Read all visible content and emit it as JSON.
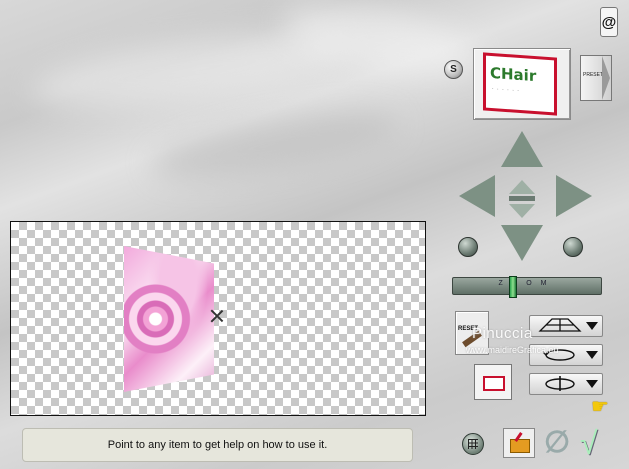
{
  "status": {
    "help_text": "Point to any item to get help on how to use it."
  },
  "preset_panel": {
    "s_label": "S",
    "thumbnail_word": "CHair",
    "thumbnail_caption": "· · · · · ·",
    "presets_label": "PRESETS"
  },
  "zoom": {
    "label": "ZOOM"
  },
  "controls": {
    "reset_label": "RESET"
  },
  "watermark": {
    "line1": "Pinuccia",
    "line2": "www.maidireGrafica.eu"
  },
  "logo": {
    "glyph": "@"
  },
  "colors": {
    "checker_dark": "#c8c8c8",
    "accent_red": "#c8102e",
    "arrow_green": "#7d9184",
    "status_bg": "#e6e6dc"
  }
}
